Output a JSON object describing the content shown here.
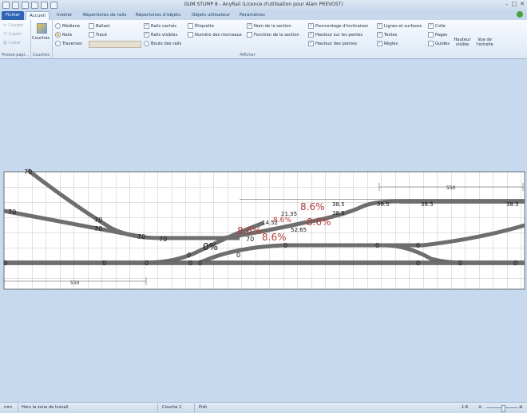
{
  "window": {
    "title": "GUM STUMP 8 - AnyRail (Licence d'utilisation pour Alain PREVOST)"
  },
  "tabs": [
    {
      "label": "Fichier"
    },
    {
      "label": "Accueil"
    },
    {
      "label": "Insérer"
    },
    {
      "label": "Répertoires de rails"
    },
    {
      "label": "Répertoires d'objets"
    },
    {
      "label": "Objets utilisateur"
    },
    {
      "label": "Paramètres"
    }
  ],
  "ribbon": {
    "clipboard": {
      "cut": "Couper",
      "copy": "Copier",
      "paste": "Coller",
      "label": "Presse-papi..."
    },
    "layers": {
      "button": "Couches",
      "label": "Couches"
    },
    "display": {
      "mediane": "Médiane",
      "rails": "Rails",
      "traverses": "Traverses",
      "ballast": "Ballast",
      "trace": "Tracé",
      "rails_caches": "Rails cachés",
      "rails_visibles": "Rails visibles",
      "bouts_des_rails": "Bouts des rails",
      "etiquette": "Étiquette",
      "numero_des_morceaux": "Numéro des morceaux",
      "nom_de_la_section": "Nom de la section",
      "fonction_de_la_section": "Fonction de la section",
      "pourcentage": "Pourcentage d'inclinaison",
      "hauteur_pentes": "Hauteur sur les pentes",
      "hauteur_plaines": "Hauteur des plaines",
      "lignes_surfaces": "Lignes et surfaces",
      "textes": "Textes",
      "regles": "Règles",
      "colle": "Colle",
      "pages": "Pages",
      "guides": "Guides",
      "label": "Afficher"
    },
    "hauteur_visible": "Hauteur visible",
    "vue_echelle": "Vue de l'échelle"
  },
  "status": {
    "units": "mm",
    "zone": "Hors la zone de travail",
    "layer": "Couche 1",
    "ready": "Prêt",
    "zoom": "1:6"
  },
  "drawing": {
    "heights": {
      "h70a": "70",
      "h70b": "70",
      "h70c": "70",
      "h70d": "70",
      "h70e": "70",
      "h70f": "70",
      "h70g": "70",
      "h0a": "0",
      "h0b": "0",
      "h0c": "0",
      "h0d": "0",
      "h0e": "0",
      "h0f": "0",
      "h0g": "0",
      "h0h": "0",
      "h0i": "0",
      "h0j": "0",
      "h0k": "0",
      "h0l": "0",
      "h0m": "0",
      "h1452": "14.52",
      "h2135": "21.35",
      "h5265": "52.65",
      "h385a": "38.5",
      "h385b": "38.5",
      "h385c": "38.5",
      "h385d": "38.5",
      "h385e": "38.5",
      "p1": "8.6%",
      "p2": "8.6%",
      "p3": "8.6%",
      "p4": "8.6%",
      "p5": "8.6%",
      "zero_pct": "0%"
    },
    "ruler_top": "550",
    "ruler_left": "550"
  }
}
